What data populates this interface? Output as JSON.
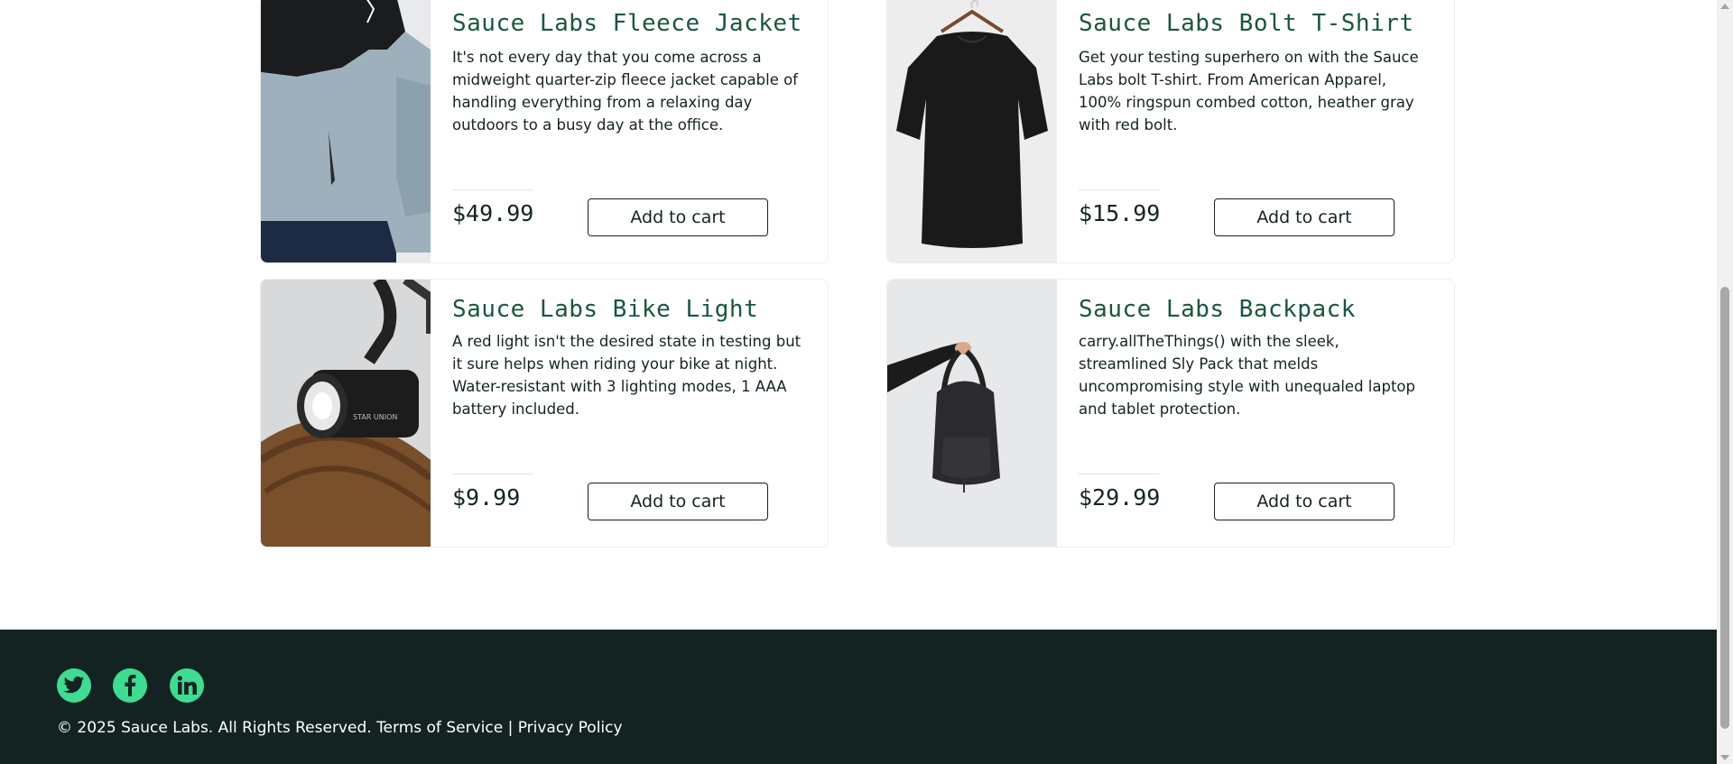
{
  "products": [
    {
      "name": "Sauce Labs Fleece Jacket",
      "description": "It's not every day that you come across a midweight quarter-zip fleece jacket capable of handling everything from a relaxing day outdoors to a busy day at the office.",
      "price": "$49.99",
      "button": "Add to cart",
      "image": "fleece-jacket-photo"
    },
    {
      "name": "Sauce Labs Bolt T-Shirt",
      "description": "Get your testing superhero on with the Sauce Labs bolt T-shirt. From American Apparel, 100% ringspun combed cotton, heather gray with red bolt.",
      "price": "$15.99",
      "button": "Add to cart",
      "image": "black-tshirt-photo"
    },
    {
      "name": "Sauce Labs Bike Light",
      "description": "A red light isn't the desired state in testing but it sure helps when riding your bike at night. Water-resistant with 3 lighting modes, 1 AAA battery included.",
      "price": "$9.99",
      "button": "Add to cart",
      "image": "bike-light-photo",
      "image_text": "STAR UNION"
    },
    {
      "name": "Sauce Labs Backpack",
      "description": "carry.allTheThings() with the sleek, streamlined Sly Pack that melds uncompromising style with unequaled laptop and tablet protection.",
      "price": "$29.99",
      "button": "Add to cart",
      "image": "backpack-photo"
    }
  ],
  "footer": {
    "social": [
      {
        "name": "twitter-icon"
      },
      {
        "name": "facebook-icon"
      },
      {
        "name": "linkedin-icon"
      }
    ],
    "copyright": "© 2025 Sauce Labs. All Rights Reserved.",
    "terms": "Terms of Service",
    "separator": "|",
    "privacy": "Privacy Policy"
  },
  "colors": {
    "product_name": "#18583a",
    "footer_bg": "#132322",
    "social_accent": "#3ddc91"
  }
}
